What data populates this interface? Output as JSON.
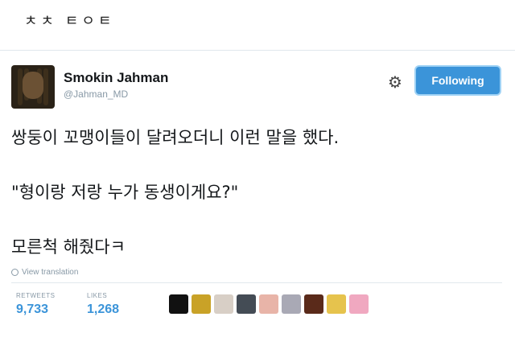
{
  "caption": "ㅊㅊ ㅌㅇㅌ",
  "tweet": {
    "author_name": "Smokin Jahman",
    "author_handle": "@Jahman_MD",
    "follow_label": "Following",
    "lines": [
      "쌍둥이 꼬맹이들이 달려오더니 이런 말을 했다.",
      "\"형이랑 저랑 누가 동생이게요?\"",
      "모른척 해줬다ㅋ"
    ],
    "translate_label": "View translation",
    "stats": {
      "retweets_label": "RETWEETS",
      "retweets_value": "9,733",
      "likes_label": "LIKES",
      "likes_value": "1,268"
    },
    "liker_colors": [
      "#111111",
      "#c9a227",
      "#d8cfc6",
      "#444c55",
      "#e8b4a8",
      "#a9a9b5",
      "#5a2a1a",
      "#e6c34d",
      "#f0a8c0"
    ]
  },
  "colors": {
    "accent": "#3b94d9",
    "muted": "#8899a6"
  }
}
